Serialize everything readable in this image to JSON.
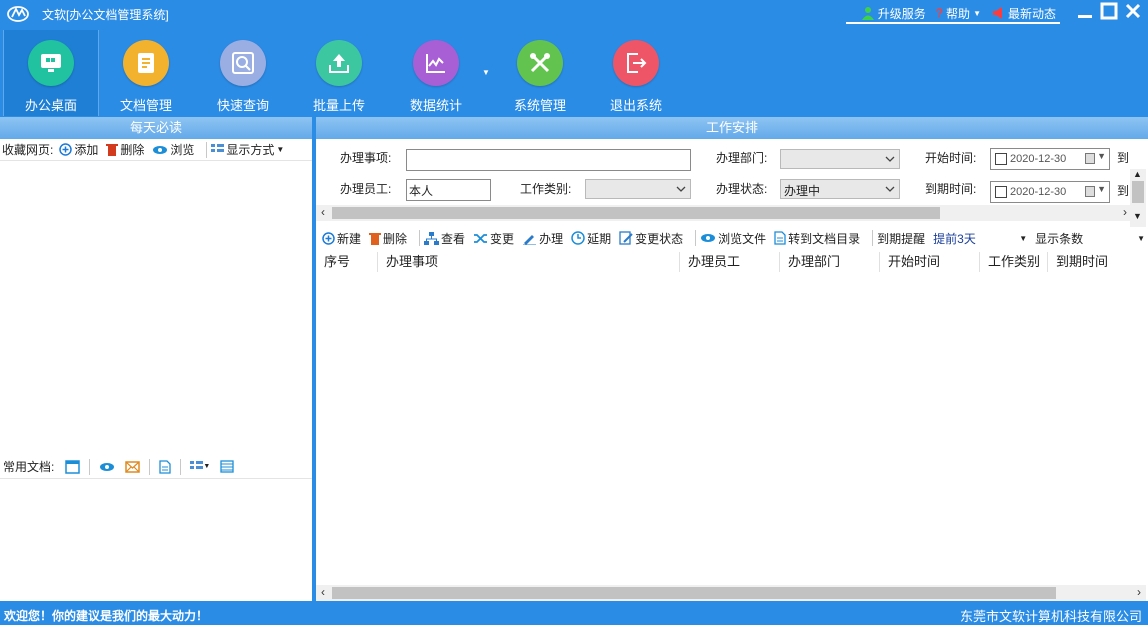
{
  "window": {
    "title": "文软[办公文档管理系统]",
    "links": [
      {
        "icon": "person-up-icon",
        "label": "升级服务"
      },
      {
        "icon": "help-icon",
        "label": "帮助"
      },
      {
        "icon": "speaker-icon",
        "label": "最新动态"
      }
    ]
  },
  "toolbar": {
    "items": [
      {
        "label": "办公桌面",
        "icon": "desktop-icon",
        "color": "#20c2a0"
      },
      {
        "label": "文档管理",
        "icon": "document-icon",
        "color": "#f3b22d"
      },
      {
        "label": "快速查询",
        "icon": "search-icon",
        "color": "#9aaee4"
      },
      {
        "label": "批量上传",
        "icon": "upload-icon",
        "color": "#3dc7a1"
      },
      {
        "label": "数据统计",
        "icon": "chart-icon",
        "color": "#a85fd6"
      },
      {
        "label": "系统管理",
        "icon": "tools-icon",
        "color": "#62c44e"
      },
      {
        "label": "退出系统",
        "icon": "exit-icon",
        "color": "#ee5566"
      }
    ]
  },
  "left": {
    "header": "每天必读",
    "fav_label": "收藏网页:",
    "fav_actions": [
      "添加",
      "删除",
      "浏览"
    ],
    "display_mode": "显示方式",
    "docs_label": "常用文档:"
  },
  "right": {
    "header": "工作安排",
    "form": {
      "item_label": "办理事项:",
      "item_value": "",
      "dept_label": "办理部门:",
      "dept_value": "",
      "start_label": "开始时间:",
      "start_value": "2020-12-30",
      "cut_label_1": "到",
      "staff_label": "办理员工:",
      "staff_value": "本人",
      "type_label": "工作类别:",
      "type_value": "",
      "status_label": "办理状态:",
      "status_value": "办理中",
      "due_label": "到期时间:",
      "due_value": "2020-12-30",
      "cut_label_2": "到"
    },
    "actions": [
      "新建",
      "删除",
      "查看",
      "变更",
      "办理",
      "延期",
      "变更状态",
      "浏览文件",
      "转到文档目录"
    ],
    "remind_label": "到期提醒",
    "remind_value": "提前3天",
    "show_count": "显示条数",
    "columns": [
      "序号",
      "办理事项",
      "办理员工",
      "办理部门",
      "开始时间",
      "工作类别",
      "到期时间"
    ]
  },
  "status": {
    "left": "欢迎您！你的建议是我们的最大动力！",
    "right": "东莞市文软计算机科技有限公司"
  },
  "colors": {
    "app_bg": "#2b8ce6",
    "panel_header": "#7ab8ef",
    "remind_text": "#1a3e9a"
  }
}
